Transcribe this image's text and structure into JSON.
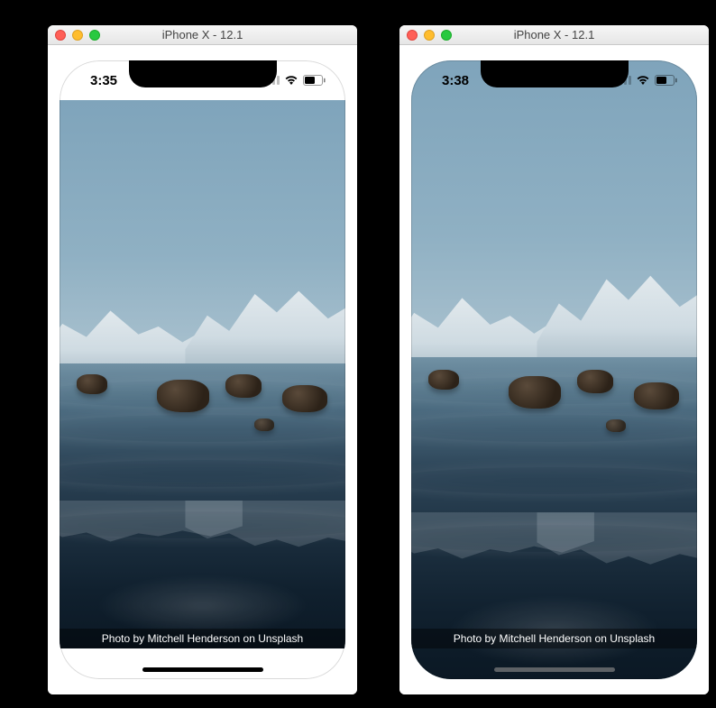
{
  "windows": [
    {
      "id": "sim_left",
      "titlebar": {
        "title": "iPhone X - 12.1"
      },
      "statusbar": {
        "time": "3:35"
      },
      "caption": "Photo by Mitchell Henderson on Unsplash"
    },
    {
      "id": "sim_right",
      "titlebar": {
        "title": "iPhone X - 12.1"
      },
      "statusbar": {
        "time": "3:38"
      },
      "caption": "Photo by Mitchell Henderson on Unsplash"
    }
  ]
}
